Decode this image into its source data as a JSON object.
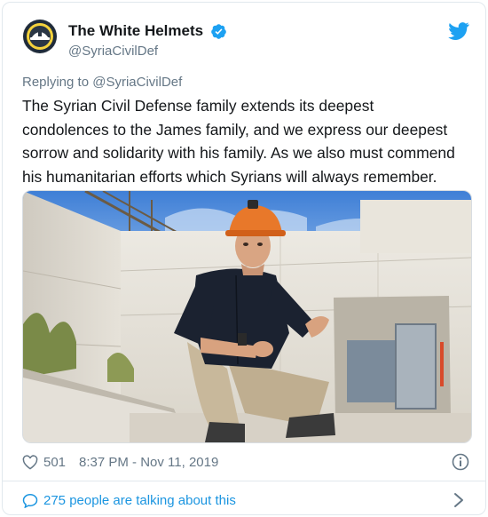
{
  "tweet": {
    "author": {
      "display_name": "The White Helmets",
      "handle": "@SyriaCivilDef",
      "verified": true,
      "avatar_icon": "white-helmets-logo"
    },
    "replying_to_label": "Replying to",
    "replying_to_handle": "@SyriaCivilDef",
    "text": "The Syrian Civil Defense family extends its deepest\ncondolences to the James family, and we express our deepest\nsorrow and solidarity with his family. As we also must commend\nhis humanitarian efforts which Syrians will always remember.",
    "media": {
      "type": "photo",
      "description_icon": "man-in-orange-helmet-photo"
    },
    "likes": "501",
    "timestamp": "8:37 PM - Nov 11, 2019",
    "talking_about": "275 people are talking about this"
  },
  "colors": {
    "twitter_blue": "#1da1f2",
    "link_blue": "#1b95e0",
    "text": "#14171a",
    "muted": "#657786",
    "border": "#e1e8ed"
  }
}
